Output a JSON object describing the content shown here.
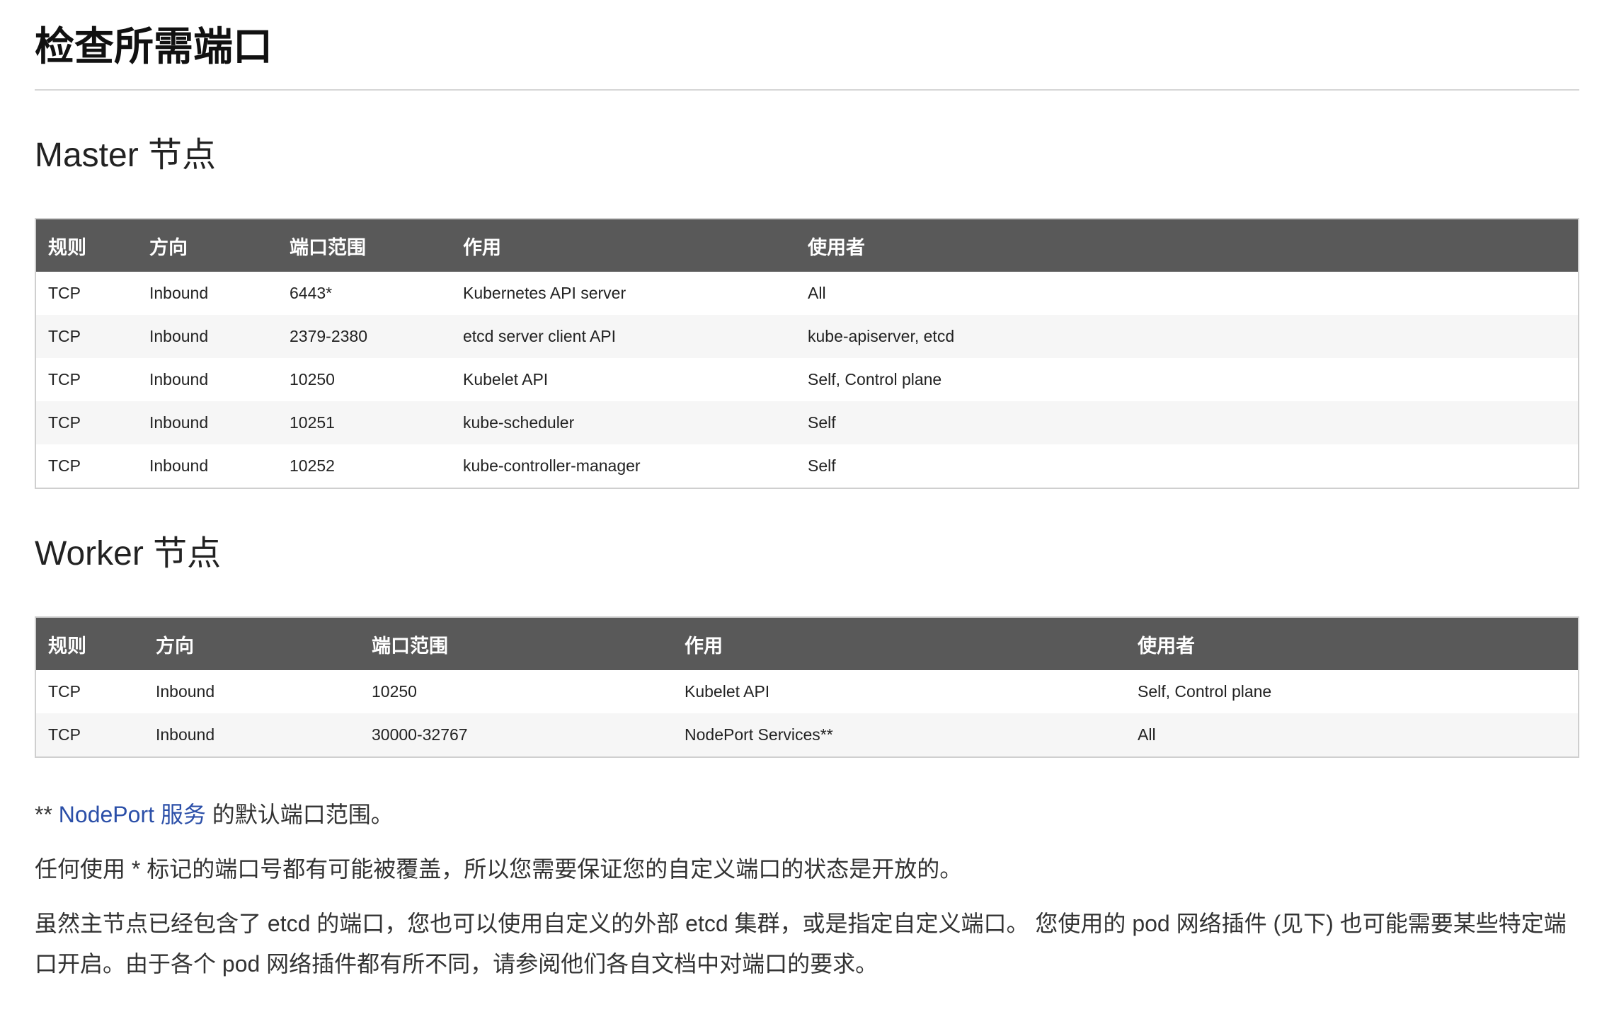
{
  "title": "检查所需端口",
  "master": {
    "heading": "Master 节点",
    "columns": [
      "规则",
      "方向",
      "端口范围",
      "作用",
      "使用者"
    ],
    "rows": [
      [
        "TCP",
        "Inbound",
        "6443*",
        "Kubernetes API server",
        "All"
      ],
      [
        "TCP",
        "Inbound",
        "2379-2380",
        "etcd server client API",
        "kube-apiserver, etcd"
      ],
      [
        "TCP",
        "Inbound",
        "10250",
        "Kubelet API",
        "Self, Control plane"
      ],
      [
        "TCP",
        "Inbound",
        "10251",
        "kube-scheduler",
        "Self"
      ],
      [
        "TCP",
        "Inbound",
        "10252",
        "kube-controller-manager",
        "Self"
      ]
    ]
  },
  "worker": {
    "heading": "Worker 节点",
    "columns": [
      "规则",
      "方向",
      "端口范围",
      "作用",
      "使用者"
    ],
    "rows": [
      [
        "TCP",
        "Inbound",
        "10250",
        "Kubelet API",
        "Self, Control plane"
      ],
      [
        "TCP",
        "Inbound",
        "30000-32767",
        "NodePort Services**",
        "All"
      ]
    ]
  },
  "notes": {
    "nodeport_prefix": "** ",
    "nodeport_link": "NodePort 服务",
    "nodeport_suffix": " 的默认端口范围。",
    "override": "任何使用 * 标记的端口号都有可能被覆盖，所以您需要保证您的自定义端口的状态是开放的。",
    "etcd": "虽然主节点已经包含了 etcd 的端口，您也可以使用自定义的外部 etcd 集群，或是指定自定义端口。 您使用的 pod 网络插件 (见下) 也可能需要某些特定端口开启。由于各个 pod 网络插件都有所不同，请参阅他们各自文档中对端口的要求。"
  }
}
